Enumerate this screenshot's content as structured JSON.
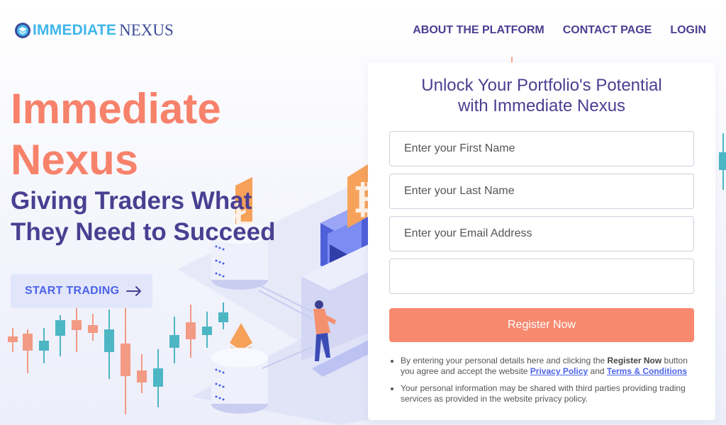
{
  "header": {
    "logo_part1": "IMMEDIATE",
    "logo_part2": "NEXUS",
    "nav": [
      "ABOUT THE PLATFORM",
      "CONTACT PAGE",
      "LOGIN"
    ]
  },
  "hero": {
    "title_line1": "Immediate",
    "title_line2": "Nexus",
    "subtitle_line1": "Giving Traders What",
    "subtitle_line2": "They Need to Succeed",
    "cta_label": "START TRADING"
  },
  "form": {
    "title_line1": "Unlock Your Portfolio's Potential",
    "title_line2": "with Immediate Nexus",
    "first_name_placeholder": "Enter your First Name",
    "last_name_placeholder": "Enter your Last Name",
    "email_placeholder": "Enter your Email Address",
    "phone_placeholder": "",
    "submit_label": "Register Now",
    "note1_pre": "By entering your personal details here and clicking the ",
    "note1_bold": "Register Now",
    "note1_mid": " button you agree and accept the website ",
    "note1_link1": "Privacy Policy",
    "note1_and": " and ",
    "note1_link2": "Terms & Conditions",
    "note2": "Your personal information may be shared with third parties providing trading services as provided in the website privacy policy."
  },
  "colors": {
    "accent_orange": "#f7826b",
    "brand_purple": "#4a3f91",
    "brand_blue": "#4c63e8",
    "logo_cyan": "#3fb6ea",
    "candle_up": "#4db6c4",
    "candle_down": "#f39a84"
  }
}
